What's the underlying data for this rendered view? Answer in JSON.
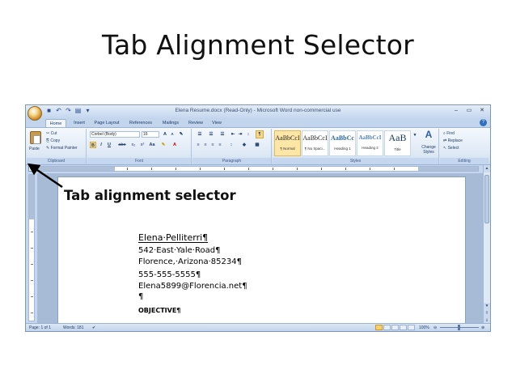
{
  "slide": {
    "title": "Tab Alignment Selector",
    "callout": "Tab alignment selector"
  },
  "window": {
    "title": "Elena Resume.docx (Read-Only) - Microsoft Word non-commercial use",
    "controls": [
      "–",
      "▭",
      "✕"
    ]
  },
  "quick_access": [
    "save-icon",
    "undo-icon",
    "redo-icon",
    "print-icon"
  ],
  "tabs": [
    {
      "label": "Home",
      "active": true
    },
    {
      "label": "Insert"
    },
    {
      "label": "Page Layout"
    },
    {
      "label": "References"
    },
    {
      "label": "Mailings"
    },
    {
      "label": "Review"
    },
    {
      "label": "View"
    }
  ],
  "ribbon": {
    "clipboard": {
      "label": "Clipboard",
      "paste": "Paste",
      "cut": "Cut",
      "copy": "Copy",
      "format_painter": "Format Painter"
    },
    "font": {
      "label": "Font",
      "family": "Corbel (Body)",
      "size": "16",
      "grow": "A",
      "shrink": "A",
      "bold": "B",
      "italic": "I",
      "underline": "U",
      "strike": "abe",
      "subscript": "x₂",
      "superscript": "x²",
      "change_case": "Aa"
    },
    "paragraph": {
      "label": "Paragraph",
      "show_marks": "¶"
    },
    "styles": {
      "label": "Styles",
      "items": [
        {
          "sample": "AaBbCcI",
          "name": "¶ Normal",
          "selected": true
        },
        {
          "sample": "AaBbCcI",
          "name": "¶ No Spaci..."
        },
        {
          "sample": "AaBbCc",
          "name": "Heading 1"
        },
        {
          "sample": "AaBbCcI",
          "name": "Heading 2"
        },
        {
          "sample": "AaB",
          "name": "Title"
        }
      ],
      "change_styles": "Change Styles"
    },
    "editing": {
      "label": "Editing",
      "find": "Find",
      "replace": "Replace",
      "select": "Select"
    }
  },
  "ruler": {
    "tab_selector_glyph": "L"
  },
  "document": {
    "lines": [
      "Elena·Pelliterri¶",
      "542·East·Yale·Road¶",
      "Florence,·Arizona·85234¶",
      "555-555-5555¶",
      "Elena5899@Florencia.net¶",
      "¶",
      "OBJECTIVE¶"
    ]
  },
  "status": {
    "page": "Page: 1 of 1",
    "words": "Words: 181",
    "zoom": "100%"
  }
}
